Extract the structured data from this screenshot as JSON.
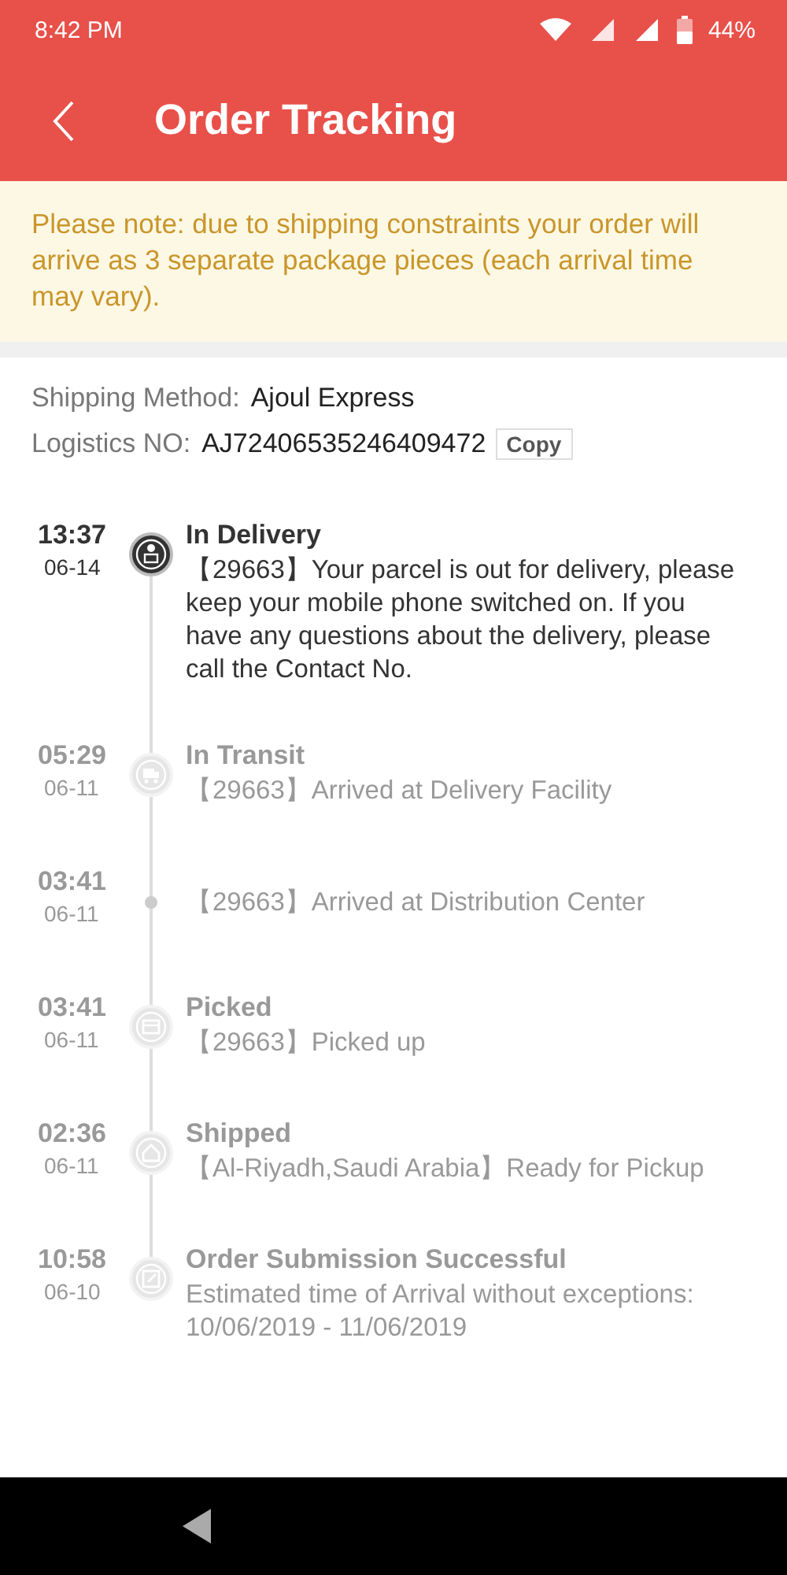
{
  "status_bar": {
    "time": "8:42 PM",
    "battery": "44%"
  },
  "header": {
    "title": "Order Tracking"
  },
  "notice": "Please note: due to shipping constraints your order will arrive as 3 separate package pieces (each arrival time may vary).",
  "shipping": {
    "method_label": "Shipping Method:",
    "method": "Ajoul Express",
    "logistics_label": "Logistics NO:",
    "logistics_no": "AJ72406535246409472",
    "copy_button": "Copy"
  },
  "events": [
    {
      "time": "13:37",
      "date": "06-14",
      "title": "In Delivery",
      "description": "【29663】Your parcel is out for delivery, please keep your mobile phone switched on. If you have any questions about the delivery, please call the Contact No.",
      "kind": "courier",
      "active": true
    },
    {
      "time": "05:29",
      "date": "06-11",
      "title": "In Transit",
      "description": "【29663】Arrived at Delivery Facility",
      "kind": "truck",
      "active": false
    },
    {
      "time": "03:41",
      "date": "06-11",
      "description": "【29663】Arrived at Distribution Center",
      "kind": "dot",
      "active": false
    },
    {
      "time": "03:41",
      "date": "06-11",
      "title": "Picked",
      "description": "【29663】Picked up",
      "kind": "box",
      "active": false
    },
    {
      "time": "02:36",
      "date": "06-11",
      "title": "Shipped",
      "description": "【Al-Riyadh,Saudi Arabia】Ready for Pickup",
      "kind": "house",
      "active": false
    },
    {
      "time": "10:58",
      "date": "06-10",
      "title": "Order Submission Successful",
      "description": "Estimated time of Arrival without exceptions: 10/06/2019 - 11/06/2019",
      "kind": "note",
      "active": false
    }
  ]
}
